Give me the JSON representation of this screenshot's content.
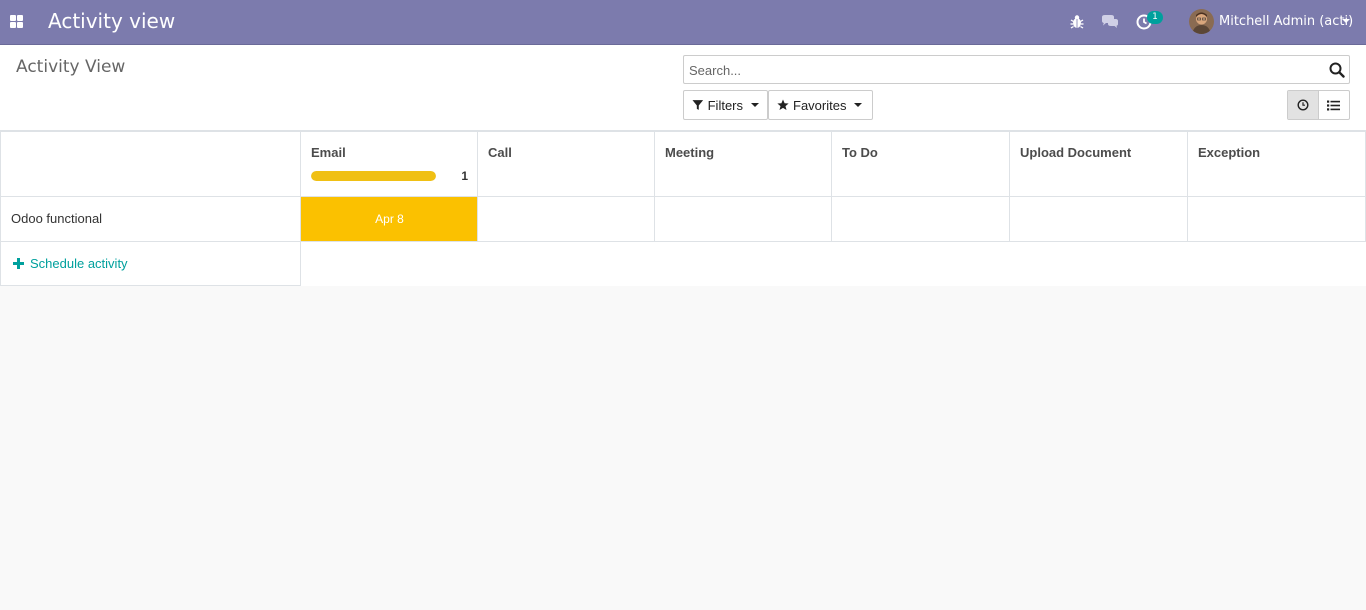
{
  "app": {
    "title": "Activity view"
  },
  "systray": {
    "activity_badge": "1",
    "user_name": "Mitchell Admin (acti)"
  },
  "control_panel": {
    "breadcrumb": "Activity View",
    "search_placeholder": "Search...",
    "filters_label": "Filters",
    "favorites_label": "Favorites"
  },
  "table": {
    "columns": [
      {
        "label": "Email",
        "count": "1",
        "progress": 1.0
      },
      {
        "label": "Call"
      },
      {
        "label": "Meeting"
      },
      {
        "label": "To Do"
      },
      {
        "label": "Upload Document"
      },
      {
        "label": "Exception"
      }
    ],
    "records": [
      {
        "name": "Odoo functional",
        "email_date": "Apr 8"
      }
    ],
    "schedule_label": "Schedule activity"
  },
  "colors": {
    "navbar": "#7c7bad",
    "accent": "#00a09d",
    "activity_planned": "#fbc100"
  }
}
